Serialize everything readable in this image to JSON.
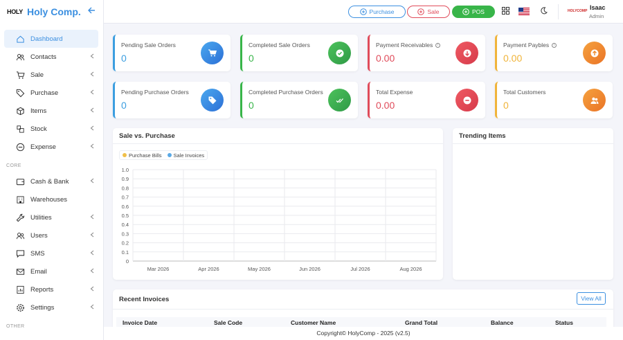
{
  "brand": {
    "logo_text": "HOLY",
    "name": "Holy Comp."
  },
  "sidebar": {
    "items": [
      {
        "label": "Dashboard",
        "icon": "home-icon",
        "active": true,
        "chevron": false
      },
      {
        "label": "Contacts",
        "icon": "contacts-icon",
        "chevron": true
      },
      {
        "label": "Sale",
        "icon": "cart-icon",
        "chevron": true
      },
      {
        "label": "Purchase",
        "icon": "tag-icon",
        "chevron": true
      },
      {
        "label": "Items",
        "icon": "box-icon",
        "chevron": true
      },
      {
        "label": "Stock",
        "icon": "stock-icon",
        "chevron": true
      },
      {
        "label": "Expense",
        "icon": "minus-circle-icon",
        "chevron": true
      }
    ],
    "section_core": "CORE",
    "core_items": [
      {
        "label": "Cash & Bank",
        "icon": "wallet-icon",
        "chevron": true
      },
      {
        "label": "Warehouses",
        "icon": "building-icon",
        "chevron": false
      },
      {
        "label": "Utilities",
        "icon": "wrench-icon",
        "chevron": true
      },
      {
        "label": "Users",
        "icon": "users-icon",
        "chevron": true
      },
      {
        "label": "SMS",
        "icon": "chat-icon",
        "chevron": true
      },
      {
        "label": "Email",
        "icon": "mail-icon",
        "chevron": true
      },
      {
        "label": "Reports",
        "icon": "reports-icon",
        "chevron": true
      },
      {
        "label": "Settings",
        "icon": "gear-icon",
        "chevron": true
      }
    ],
    "section_other": "OTHER"
  },
  "header": {
    "purchase_label": "Purchase",
    "sale_label": "Sale",
    "pos_label": "POS",
    "user_name": "Isaac",
    "user_role": "Admin",
    "user_logo_text": "HOLYCOMP"
  },
  "stats": [
    {
      "label": "Pending Sale Orders",
      "value": "0",
      "color": "#3b9ee0",
      "icon": "cart-icon",
      "info": false
    },
    {
      "label": "Completed Sale Orders",
      "value": "0",
      "color": "#38b549",
      "icon": "check-circle-icon",
      "info": false
    },
    {
      "label": "Payment Receivables",
      "value": "0.00",
      "color": "#e04b5a",
      "icon": "arrow-down-circle-icon",
      "info": true
    },
    {
      "label": "Payment Paybles",
      "value": "0.00",
      "color": "#f0b43a",
      "icon": "arrow-up-circle-icon",
      "info": true
    },
    {
      "label": "Pending Purchase Orders",
      "value": "0",
      "color": "#3b9ee0",
      "icon": "tag-icon",
      "info": false
    },
    {
      "label": "Completed Purchase Orders",
      "value": "0",
      "color": "#38b549",
      "icon": "double-check-icon",
      "info": false
    },
    {
      "label": "Total Expense",
      "value": "0.00",
      "color": "#e04b5a",
      "icon": "minus-circle-icon",
      "info": false
    },
    {
      "label": "Total Customers",
      "value": "0",
      "color": "#f0b43a",
      "icon": "users-icon",
      "info": false
    }
  ],
  "sale_vs_purchase": {
    "title": "Sale vs. Purchase",
    "legend": [
      {
        "name": "Purchase Bills",
        "color": "#f0c04a"
      },
      {
        "name": "Sale Invoices",
        "color": "#5aa9e6"
      }
    ]
  },
  "chart_data": {
    "type": "bar",
    "title": "Sale vs. Purchase",
    "categories": [
      "Mar 2026",
      "Apr 2026",
      "May 2026",
      "Jun 2026",
      "Jul 2026",
      "Aug 2026"
    ],
    "series": [
      {
        "name": "Purchase Bills",
        "values": [
          0,
          0,
          0,
          0,
          0,
          0
        ]
      },
      {
        "name": "Sale Invoices",
        "values": [
          0,
          0,
          0,
          0,
          0,
          0
        ]
      }
    ],
    "yticks": [
      "1.0",
      "0.9",
      "0.8",
      "0.7",
      "0.6",
      "0.5",
      "0.4",
      "0.3",
      "0.2",
      "0.1",
      "0"
    ],
    "ylim": [
      0,
      1
    ],
    "grid": true,
    "legend_position": "top-left"
  },
  "trending": {
    "title": "Trending Items"
  },
  "recent_invoices": {
    "title": "Recent Invoices",
    "view_all": "View All",
    "columns": [
      "Invoice Date",
      "Sale Code",
      "Customer Name",
      "Grand Total",
      "Balance",
      "Status"
    ]
  },
  "footer": {
    "text": "Copyright© HolyComp - 2025 (v2.5)"
  }
}
